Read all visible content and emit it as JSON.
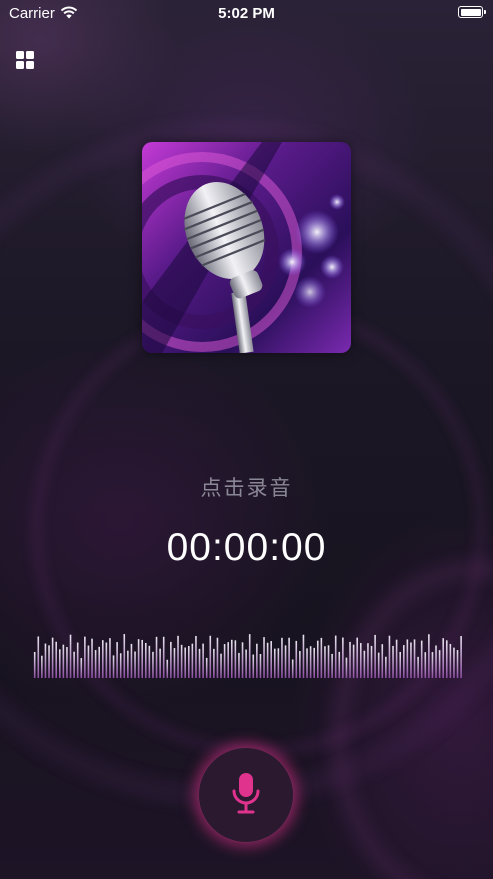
{
  "status_bar": {
    "carrier": "Carrier",
    "time": "5:02 PM"
  },
  "toolbar": {
    "menu_icon": "grid-icon"
  },
  "cover": {
    "icon": "microphone-cover-art"
  },
  "record": {
    "hint": "点击录音",
    "timer": "00:00:00",
    "button_icon": "microphone-icon",
    "accent_color": "#e0338e"
  },
  "waveform": {
    "bar_count": 120,
    "color_top": "#e8e4ee",
    "color_bottom": "#8a4ca0"
  }
}
